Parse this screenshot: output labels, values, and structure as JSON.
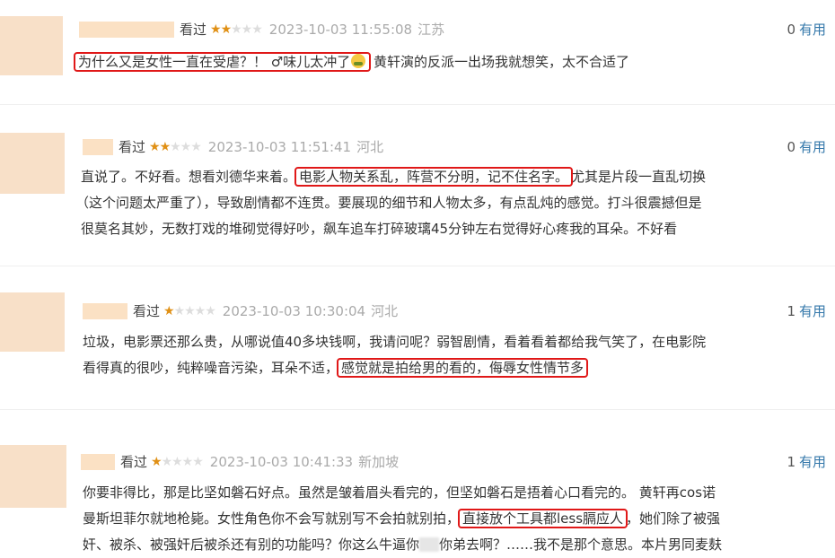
{
  "reviews": [
    {
      "watched": "看过",
      "stars_on": "★★",
      "stars_off": "★★★",
      "time": "2023-10-03 11:55:08",
      "location": "江苏",
      "useful_count": "0",
      "useful_label": "有用",
      "hl": "为什么又是女性一直在受虐？！ ♂味儿太冲了",
      "after": " 黄轩演的反派一出场我就想笑，太不合适了"
    },
    {
      "watched": "看过",
      "stars_on": "★★",
      "stars_off": "★★★",
      "time": "2023-10-03 11:51:41",
      "location": "河北",
      "useful_count": "0",
      "useful_label": "有用",
      "before": "直说了。不好看。想看刘德华来着。",
      "hl": "电影人物关系乱，阵营不分明，记不住名字。",
      "after": "尤其是片段一直乱切换",
      "line2": "（这个问题太严重了），导致剧情都不连贯。要展现的细节和人物太多，有点乱炖的感觉。打斗很震撼但是",
      "line3": "很莫名其妙，无数打戏的堆砌觉得好吵，飙车追车打碎玻璃45分钟左右觉得好心疼我的耳朵。不好看"
    },
    {
      "watched": "看过",
      "stars_on": "★",
      "stars_off": "★★★★",
      "time": "2023-10-03 10:30:04",
      "location": "河北",
      "useful_count": "1",
      "useful_label": "有用",
      "line1": "垃圾，电影票还那么贵，从哪说值40多块钱啊，我请问呢？弱智剧情，看着看着都给我气笑了，在电影院",
      "before": "看得真的很吵，纯粹噪音污染，耳朵不适，",
      "hl": "感觉就是拍给男的看的，侮辱女性情节多"
    },
    {
      "watched": "看过",
      "stars_on": "★",
      "stars_off": "★★★★",
      "time": "2023-10-03 10:41:33",
      "location": "新加坡",
      "useful_count": "1",
      "useful_label": "有用",
      "line1": "你要非得比，那是比坚如磐石好点。虽然是皱着眉头看完的，但坚如磐石是捂着心口看完的。 黄轩再cos诺",
      "before": "曼斯坦菲尔就地枪毙。女性角色你不会写就别写不会拍就别拍，",
      "hl": "直接放个工具都less膈应人",
      "after": "，她们除了被强",
      "line3a": "奸、被杀、被强奸后被杀还有别的功能吗？你这么牛逼你",
      "line3b": "你弟去啊？……我不是那个意思。本片男同麦麸"
    }
  ]
}
